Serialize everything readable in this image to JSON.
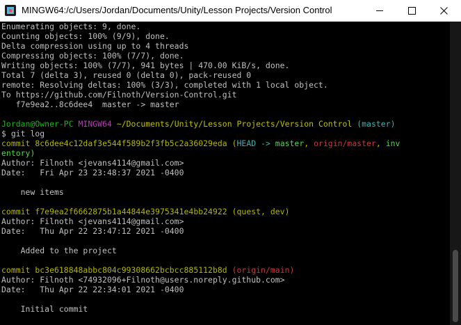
{
  "window": {
    "title": "MINGW64:/c/Users/Jordan/Documents/Unity/Lesson Projects/Version Control"
  },
  "colors": {
    "background": "#000000",
    "text": "#c0c0c0",
    "titlebar": "#ffffff"
  },
  "terminal": {
    "lines": [
      {
        "text": "Enumerating objects: 9, done."
      },
      {
        "text": "Counting objects: 100% (9/9), done."
      },
      {
        "text": "Delta compression using up to 4 threads"
      },
      {
        "text": "Compressing objects: 100% (7/7), done."
      },
      {
        "text": "Writing objects: 100% (7/7), 941 bytes | 470.00 KiB/s, done."
      },
      {
        "text": "Total 7 (delta 3), reused 0 (delta 0), pack-reused 0"
      },
      {
        "text": "remote: Resolving deltas: 100% (3/3), completed with 1 local object."
      },
      {
        "text": "To https://github.com/Filnoth/Version-Control.git"
      },
      {
        "text": "   f7e9ea2..8c6dee4  master -> master"
      },
      {
        "text": ""
      },
      {
        "prompt": {
          "user": "Jordan@Owner-PC",
          "env": "MINGW64",
          "path": "~/Documents/Unity/Lesson Projects/Version Control",
          "branch": "(master)"
        }
      },
      {
        "text": "$ git log"
      },
      {
        "commit": {
          "label": "commit ",
          "hash": "8c6dee4c12daf3e544f589b2f3fb5c2a36029eda",
          "refs_open": "(",
          "head": "HEAD -> ",
          "local": "master",
          "sep1": ", ",
          "remote": "origin/master",
          "sep2": ", ",
          "other": "inv",
          "close": ""
        }
      },
      {
        "text": "entory)"
      },
      {
        "text": "Author: Filnoth <jevans4114@gmail.com>"
      },
      {
        "text": "Date:   Fri Apr 23 23:48:37 2021 -0400"
      },
      {
        "text": ""
      },
      {
        "text": "    new items"
      },
      {
        "text": ""
      },
      {
        "commit2": {
          "label": "commit ",
          "hash": "f7e9ea2f6662875b1a44844e3975341e4bb24922",
          "refs": "(quest, dev)"
        }
      },
      {
        "text": "Author: Filnoth <jevans4114@gmail.com>"
      },
      {
        "text": "Date:   Thu Apr 22 23:47:12 2021 -0400"
      },
      {
        "text": ""
      },
      {
        "text": "    Added to the project"
      },
      {
        "text": ""
      },
      {
        "commit3": {
          "label": "commit ",
          "hash": "bc3e618848abbc804c99308662bcbcc885112b8d",
          "refs": "(origin/main)"
        }
      },
      {
        "text": "Author: Filnoth <74932096+Filnoth@users.noreply.github.com>"
      },
      {
        "text": "Date:   Thu Apr 22 22:34:01 2021 -0400"
      },
      {
        "text": ""
      },
      {
        "text": "    Initial commit"
      }
    ]
  }
}
